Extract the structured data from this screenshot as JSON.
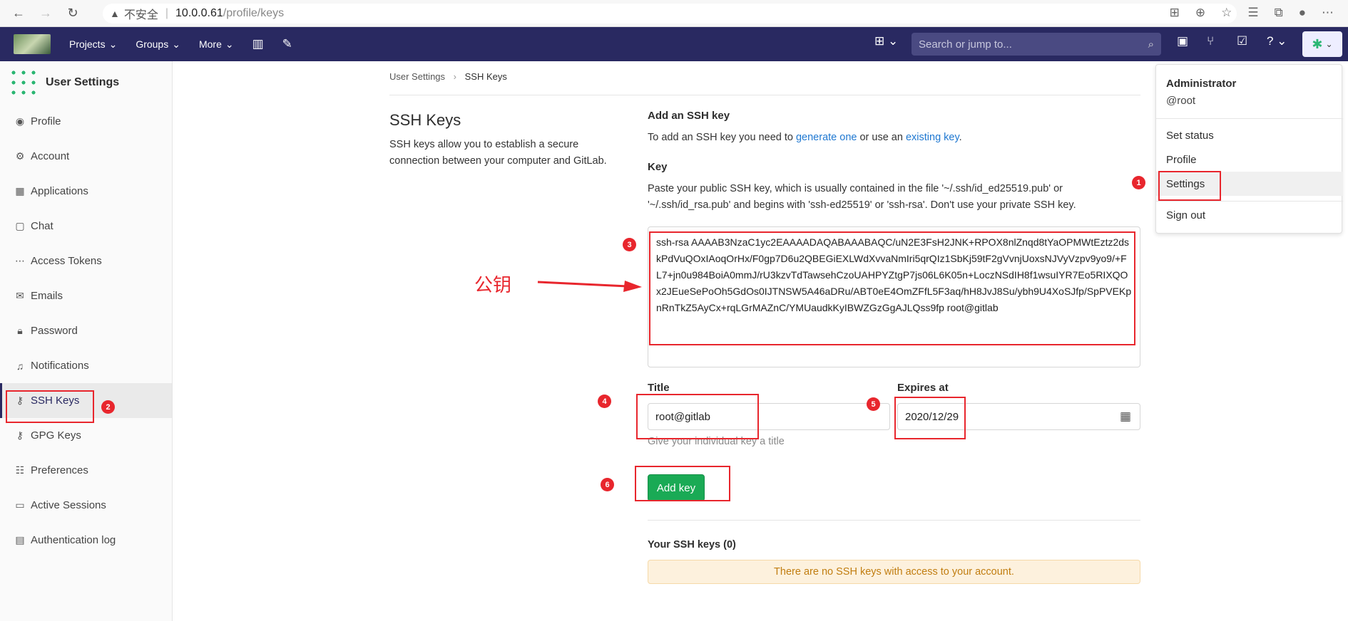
{
  "browser": {
    "insecure_label": "不安全",
    "host": "10.0.0.61",
    "path": "/profile/keys"
  },
  "topnav": {
    "projects": "Projects",
    "groups": "Groups",
    "more": "More",
    "search_placeholder": "Search or jump to..."
  },
  "sidebar": {
    "title": "User Settings",
    "items": [
      {
        "label": "Profile",
        "icon": "person-icon"
      },
      {
        "label": "Account",
        "icon": "account-icon"
      },
      {
        "label": "Applications",
        "icon": "applications-icon"
      },
      {
        "label": "Chat",
        "icon": "chat-icon"
      },
      {
        "label": "Access Tokens",
        "icon": "token-icon"
      },
      {
        "label": "Emails",
        "icon": "mail-icon"
      },
      {
        "label": "Password",
        "icon": "lock-icon"
      },
      {
        "label": "Notifications",
        "icon": "bell-icon"
      },
      {
        "label": "SSH Keys",
        "icon": "key-icon"
      },
      {
        "label": "GPG Keys",
        "icon": "key-icon"
      },
      {
        "label": "Preferences",
        "icon": "sliders-icon"
      },
      {
        "label": "Active Sessions",
        "icon": "monitor-icon"
      },
      {
        "label": "Authentication log",
        "icon": "log-icon"
      }
    ]
  },
  "breadcrumb": {
    "parent": "User Settings",
    "current": "SSH Keys"
  },
  "page": {
    "title": "SSH Keys",
    "description": "SSH keys allow you to establish a secure connection between your computer and GitLab."
  },
  "form": {
    "add_heading": "Add an SSH key",
    "intro_prefix": "To add an SSH key you need to ",
    "intro_link1": "generate one",
    "intro_middle": " or use an ",
    "intro_link2": "existing key",
    "intro_suffix": ".",
    "key_label": "Key",
    "key_help": "Paste your public SSH key, which is usually contained in the file '~/.ssh/id_ed25519.pub' or '~/.ssh/id_rsa.pub' and begins with 'ssh-ed25519' or 'ssh-rsa'. Don't use your private SSH key.",
    "key_value": "ssh-rsa AAAAB3NzaC1yc2EAAAADAQABAAABAQC/uN2E3FsH2JNK+RPOX8nlZnqd8tYaOPMWtEztz2dskPdVuQOxIAoqOrHx/F0gp7D6u2QBEGiEXLWdXvvaNmIri5qrQIz1SbKj59tF2gVvnjUoxsNJVyVzpv9yo9/+FL7+jn0u984BoiA0mmJ/rU3kzvTdTawsehCzoUAHPYZtgP7js06L6K05n+LoczNSdIH8f1wsuIYR7Eo5RIXQOx2JEueSePoOh5GdOs0IJTNSW5A46aDRu/ABT0eE4OmZFfL5F3aq/hH8JvJ8Su/ybh9U4XoSJfp/SpPVEKpnRnTkZ5AyCx+rqLGrMAZnC/YMUaudkKyIBWZGzGgAJLQss9fp root@gitlab",
    "title_label": "Title",
    "title_value": "root@gitlab",
    "expires_label": "Expires at",
    "expires_value": "2020/12/29",
    "title_help": "Give your individual key a title",
    "add_button": "Add key"
  },
  "your_keys": {
    "heading": "Your SSH keys (0)",
    "empty_message": "There are no SSH keys with access to your account."
  },
  "user_dropdown": {
    "name": "Administrator",
    "username": "@root",
    "set_status": "Set status",
    "profile": "Profile",
    "settings": "Settings",
    "sign_out": "Sign out"
  },
  "annotations": {
    "label_public_key": "公钥",
    "numbers": [
      "1",
      "2",
      "3",
      "4",
      "5",
      "6"
    ],
    "color": "#e8262d"
  },
  "colors": {
    "nav_bg": "#292961",
    "primary_button": "#1aaa55",
    "link": "#1f78d1"
  }
}
